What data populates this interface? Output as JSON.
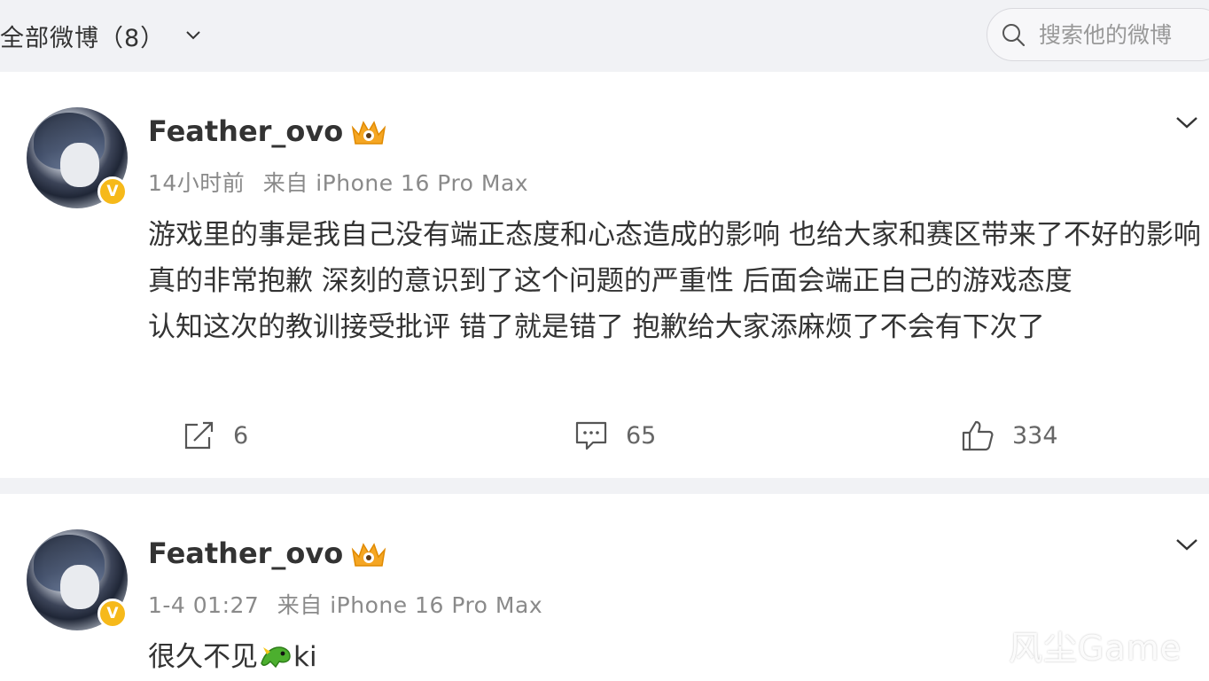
{
  "header": {
    "filter_label": "全部微博（8）",
    "search_placeholder": "搜索他的微博",
    "icons": {
      "filter_dropdown": "chevron-down-icon",
      "search": "search-icon"
    }
  },
  "posts": [
    {
      "username": "Feather_ovo",
      "verified_badge": "V",
      "time": "14小时前",
      "source": "来自 iPhone 16 Pro Max",
      "paragraphs": [
        "游戏里的事是我自己没有端正态度和心态造成的影响 也给大家和赛区带来了不好的影响 真的非常抱歉 深刻的意识到了这个问题的严重性 后面会端正自己的游戏态度",
        "认知这次的教训接受批评 错了就是错了 抱歉给大家添麻烦了不会有下次了"
      ],
      "repost_count": "6",
      "comment_count": "65",
      "like_count": "334"
    },
    {
      "username": "Feather_ovo",
      "verified_badge": "V",
      "time": "1-4 01:27",
      "source": "来自 iPhone 16 Pro Max",
      "text": "很久不见",
      "text_suffix": "ki",
      "emoji": "green-dragon-emoji"
    }
  ],
  "watermark": "风尘Game",
  "colors": {
    "page_bg": "#f1f2f5",
    "card_bg": "#ffffff",
    "text": "#333333",
    "meta": "#8a8a8a",
    "verified": "#f6b91a"
  }
}
